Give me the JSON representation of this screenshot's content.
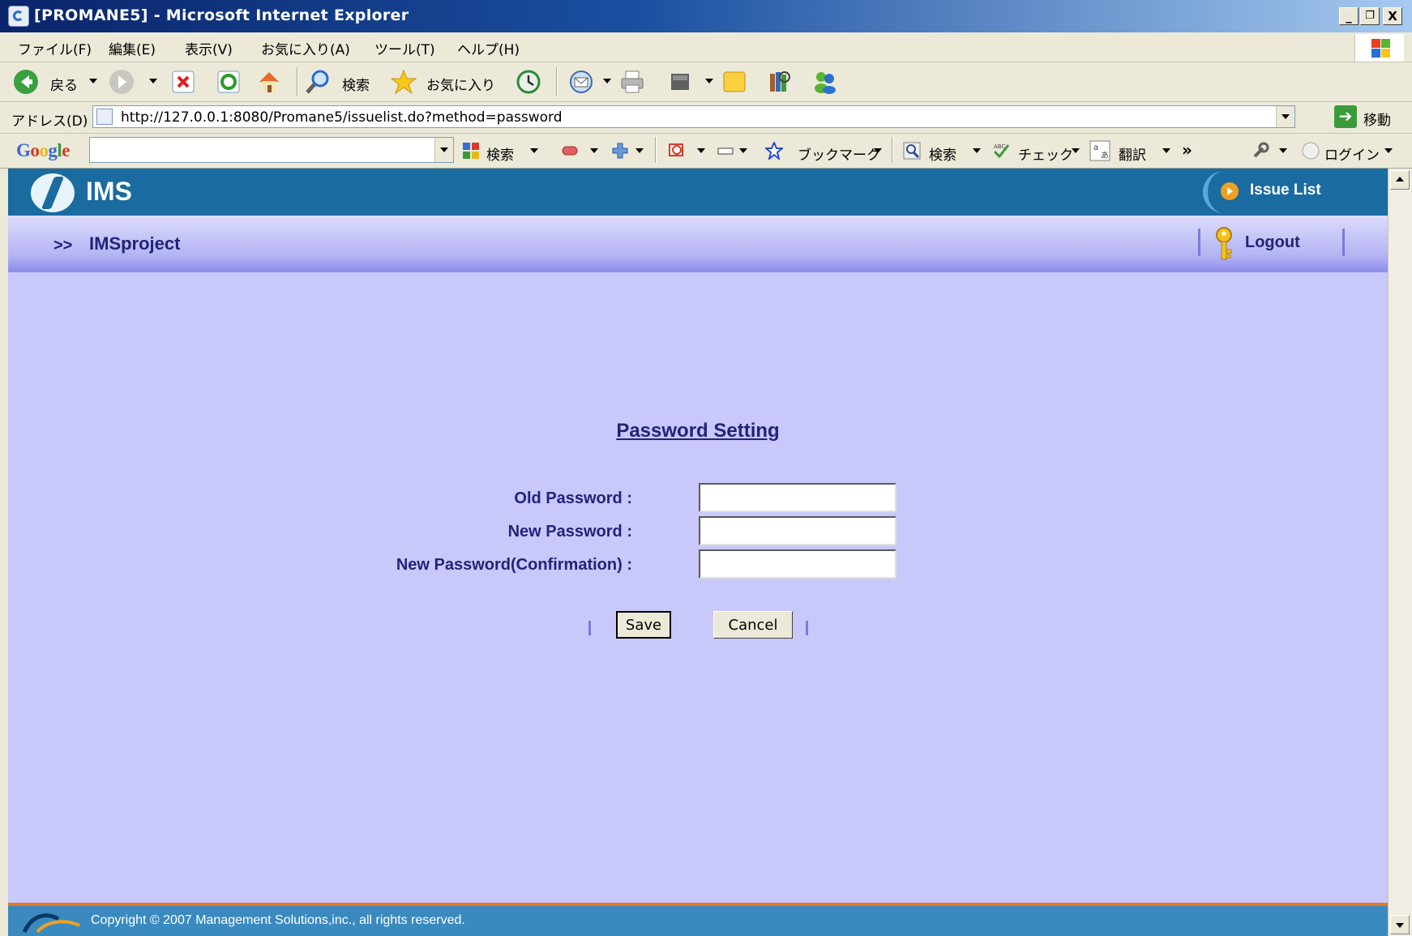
{
  "window": {
    "title": "[PROMANE5] - Microsoft Internet Explorer",
    "buttons": {
      "minimize": "_",
      "maximize": "Ő",
      "close": "X"
    }
  },
  "menu": {
    "items": [
      "ファイル(F)",
      "編集(E)",
      "表示(V)",
      "お気に入り(A)",
      "ツール(T)",
      "ヘルプ(H)"
    ]
  },
  "toolbar": {
    "back_label": "戻る",
    "search_label": "検索",
    "favorites_label": "お気に入り"
  },
  "address": {
    "label": "アドレス(D)",
    "url": "http://127.0.0.1:8080/Promane5/issuelist.do?method=password",
    "go_label": "移動"
  },
  "google_bar": {
    "logo": "Google",
    "search_value": "",
    "search_label": "検索",
    "bookmarks_label": "ブックマーク",
    "search2_label": "検索",
    "check_label": "チェック",
    "translate_label": "翻訳",
    "more_label": "»",
    "login_label": "ログイン"
  },
  "app": {
    "logo_text": "IMS",
    "issue_list_label": "Issue List",
    "breadcrumb_chevron": ">>",
    "project_name": "IMSproject",
    "logout_label": "Logout"
  },
  "form": {
    "title": "Password Setting",
    "old_password_label": "Old Password :",
    "new_password_label": "New Password :",
    "confirm_password_label": "New Password(Confirmation) :",
    "old_password_value": "",
    "new_password_value": "",
    "confirm_password_value": "",
    "save_label": "Save",
    "cancel_label": "Cancel"
  },
  "footer": {
    "copyright": "Copyright © 2007  Management Solutions,inc., all rights reserved."
  },
  "colors": {
    "page_background": "#c8c8fa",
    "header_blue": "#1a6ba0",
    "text_navy": "#23237a",
    "footer_blue": "#3a8ac0",
    "footer_accent": "#e8761a"
  }
}
